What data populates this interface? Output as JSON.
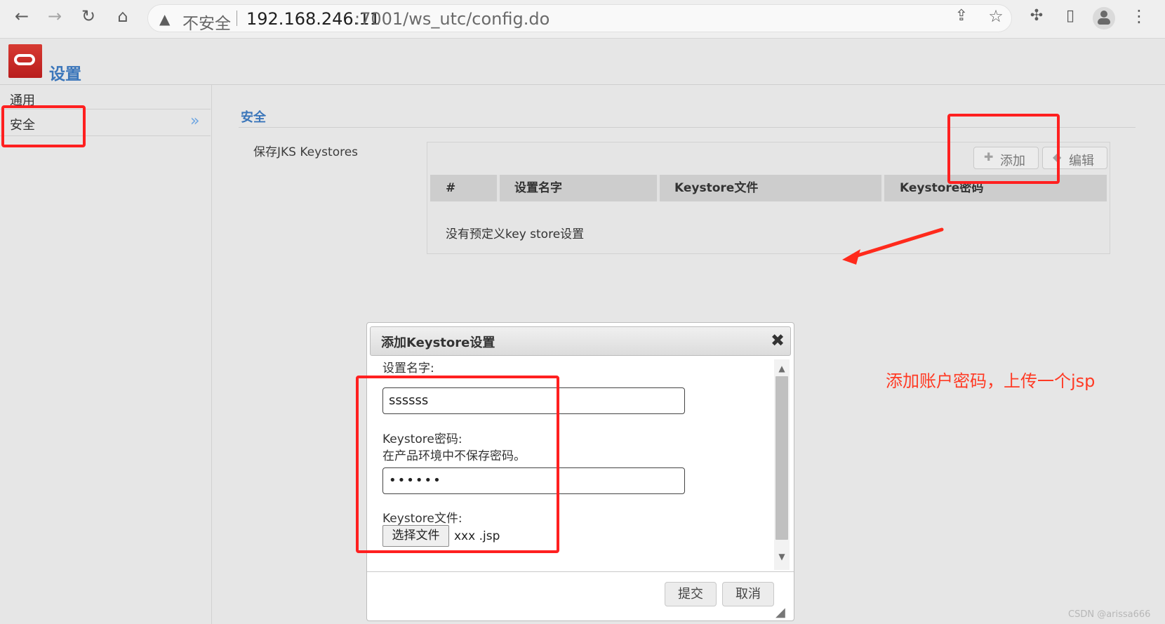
{
  "browser": {
    "insecure_label": "不安全",
    "url_host": "192.168.246.11",
    "url_path": ":7001/ws_utc/config.do"
  },
  "header": {
    "title": "设置"
  },
  "sidebar": {
    "items": [
      {
        "label": "通用"
      },
      {
        "label": "安全"
      }
    ]
  },
  "main": {
    "section_title": "安全",
    "keystore_label": "保存JKS Keystores",
    "toolbar": {
      "add_label": "添加",
      "edit_label": "编辑"
    },
    "table": {
      "columns": [
        "#",
        "设置名字",
        "Keystore文件",
        "Keystore密码"
      ],
      "empty_message": "没有预定义key store设置"
    }
  },
  "annotation": {
    "note": "添加账户密码，上传一个jsp"
  },
  "dialog": {
    "title": "添加Keystore设置",
    "setting_name_label": "设置名字:",
    "setting_name_value": "ssssss",
    "password_label": "Keystore密码:",
    "password_note": "在产品环境中不保存密码。",
    "password_value": "••••••",
    "file_label": "Keystore文件:",
    "file_button_label": "选择文件",
    "file_name": "xxx .jsp",
    "submit_label": "提交",
    "cancel_label": "取消"
  },
  "watermark": {
    "text": "CSDN @arissa666"
  },
  "icons": {
    "back": "back-arrow-icon",
    "forward": "forward-arrow-icon",
    "reload": "reload-icon",
    "home": "home-icon",
    "warning": "warning-icon",
    "share": "share-icon",
    "star": "star-icon",
    "extensions": "puzzle-icon",
    "panel": "side-panel-icon",
    "profile": "avatar",
    "menu": "more-vertical-icon",
    "sidebar_expand": "double-chevron-icon",
    "add": "plus-icon",
    "edit": "pencil-icon",
    "close": "close-icon",
    "resize": "resize-handle-icon"
  },
  "colors": {
    "accent": "#3b76ba",
    "annotation_red": "#ff2020"
  }
}
